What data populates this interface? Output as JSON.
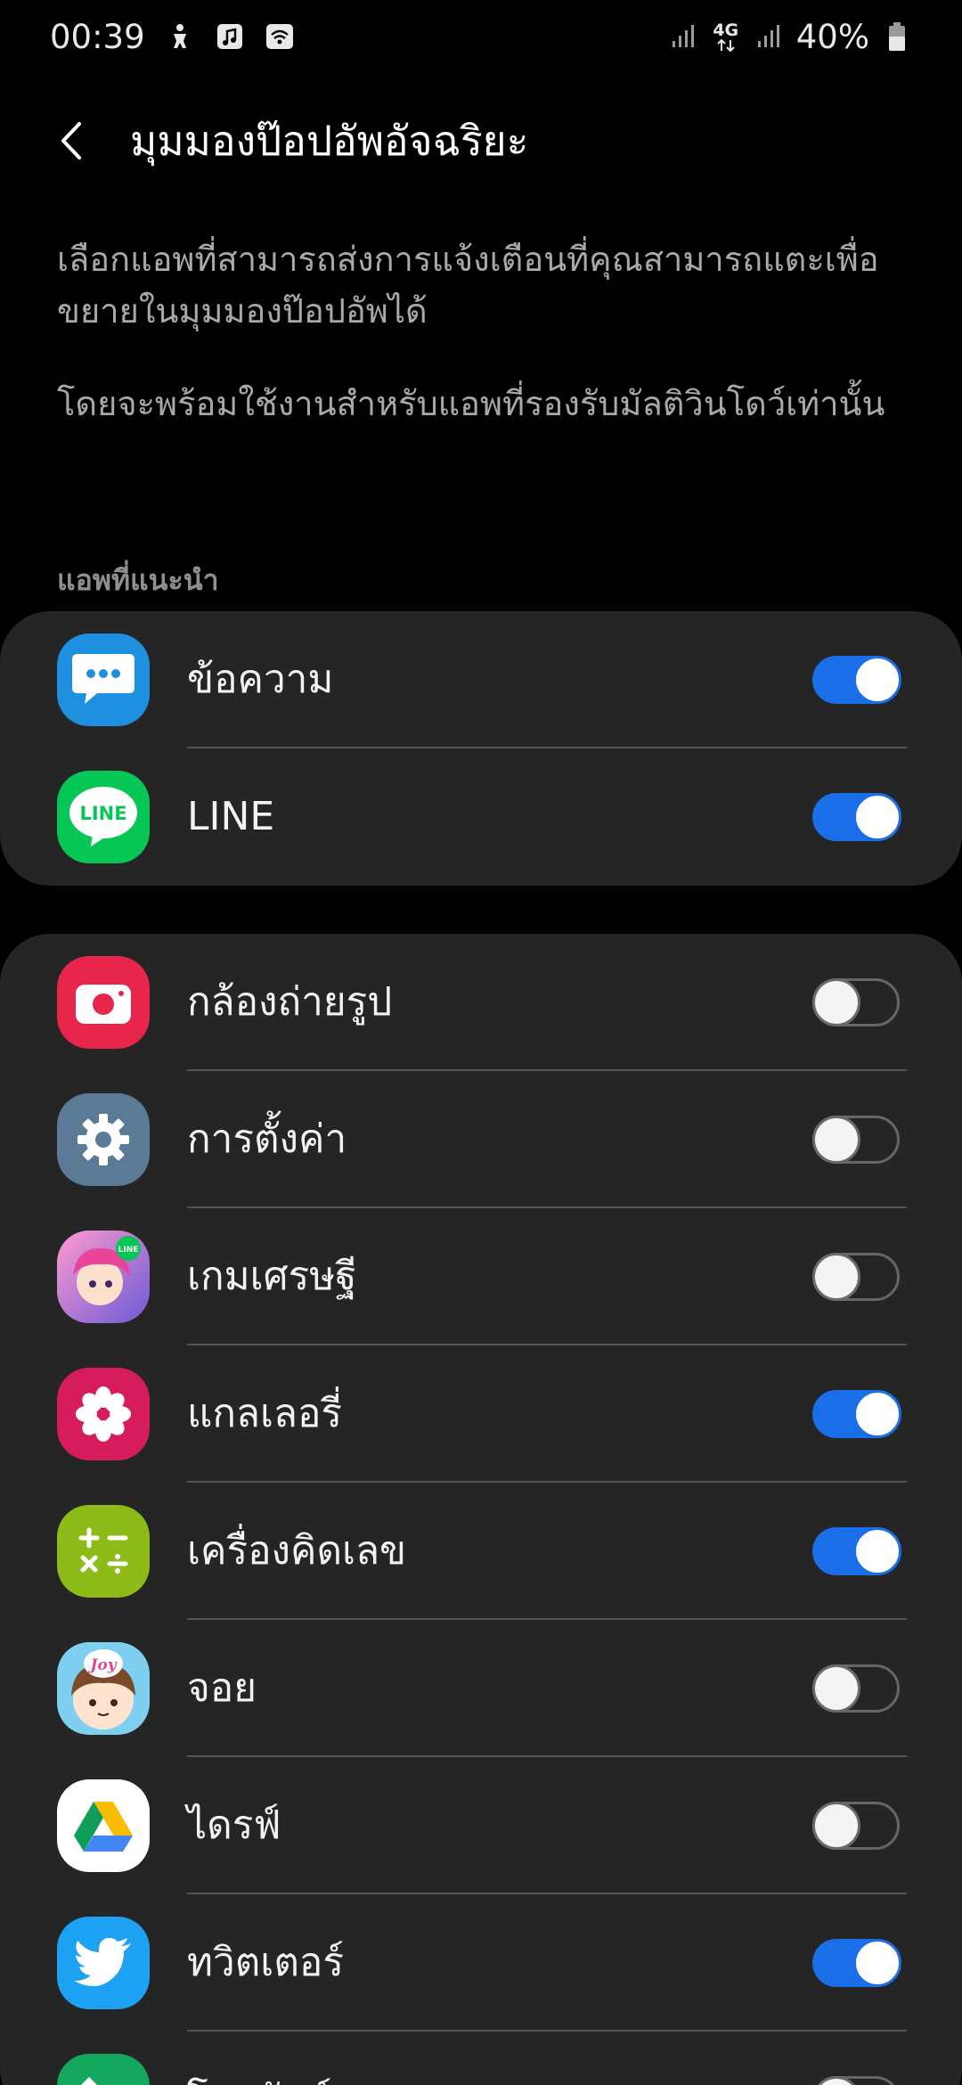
{
  "status_bar": {
    "time": "00:39",
    "network": "4G",
    "battery": "40%"
  },
  "header": {
    "title": "มุมมองป๊อปอัพอัจฉริยะ"
  },
  "description": {
    "line1": "เลือกแอพที่สามารถส่งการแจ้งเตือนที่คุณสามารถแตะเพื่อขยายในมุมมองป๊อปอัพได้",
    "line2": "โดยจะพร้อมใช้งานสำหรับแอพที่รองรับมัลติวินโดว์เท่านั้น"
  },
  "recommended": {
    "header": "แอพที่แนะนำ",
    "apps": [
      {
        "label": "ข้อความ",
        "icon": "messages-icon",
        "enabled": true
      },
      {
        "label": "LINE",
        "icon": "line-app-icon",
        "enabled": true
      }
    ]
  },
  "apps": [
    {
      "label": "กล้องถ่ายรูป",
      "icon": "camera-icon",
      "enabled": false
    },
    {
      "label": "การตั้งค่า",
      "icon": "settings-gear-icon",
      "enabled": false
    },
    {
      "label": "เกมเศรษฐี",
      "icon": "game-app-icon",
      "enabled": false
    },
    {
      "label": "แกลเลอรี่",
      "icon": "gallery-flower-icon",
      "enabled": true
    },
    {
      "label": "เครื่องคิดเลข",
      "icon": "calculator-icon",
      "enabled": true
    },
    {
      "label": "จอย",
      "icon": "joy-app-icon",
      "enabled": false
    },
    {
      "label": "ไดรฟ์",
      "icon": "drive-icon",
      "enabled": false
    },
    {
      "label": "ทวิตเตอร์",
      "icon": "twitter-bird-icon",
      "enabled": true
    },
    {
      "label": "โทรศัพท์",
      "icon": "phone-icon",
      "enabled": false
    }
  ],
  "colors": {
    "accent": "#1a6fe8",
    "card": "#252525",
    "background": "#000000"
  }
}
